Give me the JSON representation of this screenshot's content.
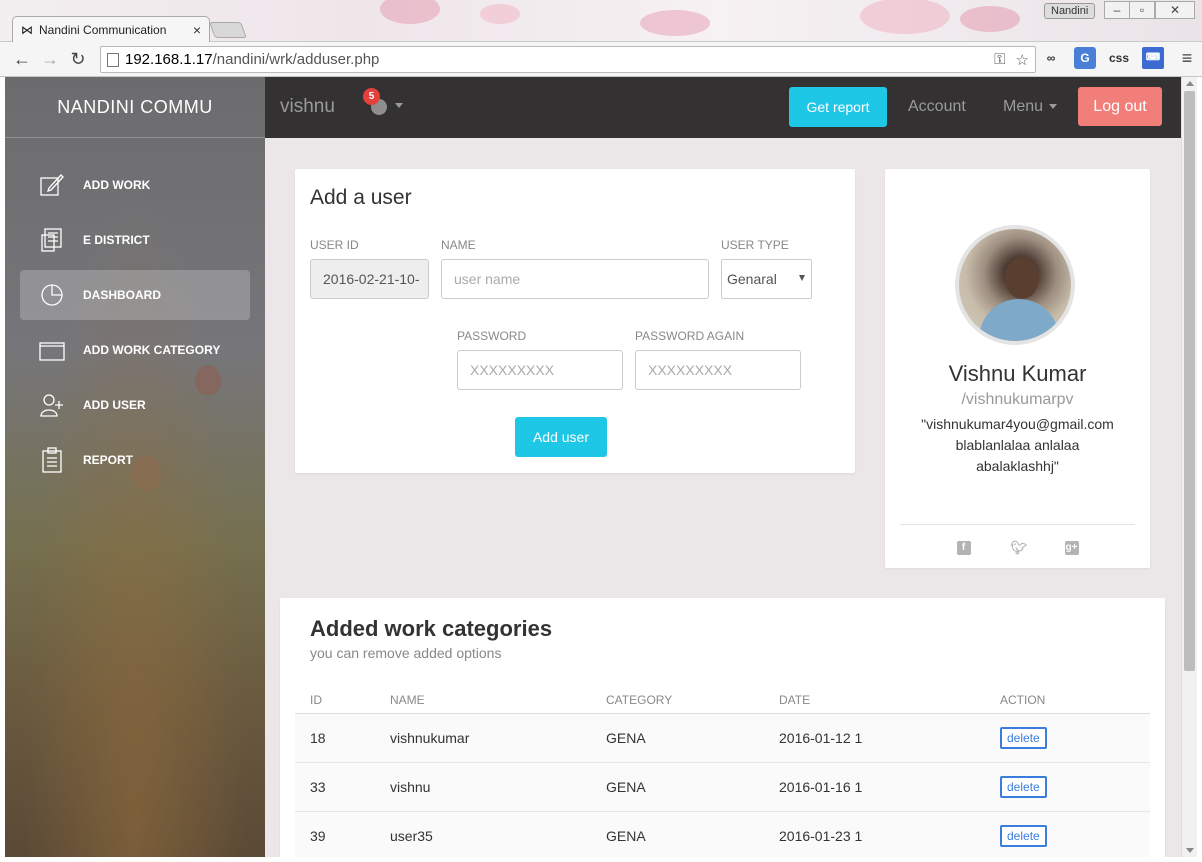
{
  "browser": {
    "tab_title": "Nandini Communication",
    "window_user": "Nandini",
    "url_host": "192.168.1.17",
    "url_path": "/nandini/wrk/adduser.php",
    "ext_css": "css"
  },
  "sidebar": {
    "brand": "NANDINI COMMU",
    "items": [
      {
        "label": "ADD WORK",
        "icon": "edit-icon"
      },
      {
        "label": "E DISTRICT",
        "icon": "document-stack-icon"
      },
      {
        "label": "DASHBOARD",
        "icon": "pie-chart-icon",
        "active": true
      },
      {
        "label": "ADD WORK CATEGORY",
        "icon": "folder-icon"
      },
      {
        "label": "ADD USER",
        "icon": "add-user-icon"
      },
      {
        "label": "REPORT",
        "icon": "clipboard-icon"
      }
    ]
  },
  "topnav": {
    "username": "vishnu",
    "notification_count": "5",
    "get_report": "Get report",
    "account": "Account",
    "menu": "Menu",
    "logout": "Log out"
  },
  "form": {
    "title": "Add a user",
    "user_id_label": "USER ID",
    "user_id_value": "2016-02-21-10-",
    "name_label": "NAME",
    "name_placeholder": "user name",
    "user_type_label": "USER TYPE",
    "user_type_value": "Genaral",
    "password_label": "PASSWORD",
    "password_placeholder": "XXXXXXXXX",
    "password_again_label": "PASSWORD AGAIN",
    "password_again_placeholder": "XXXXXXXXX",
    "submit": "Add user"
  },
  "profile": {
    "name": "Vishnu Kumar",
    "handle": "/vishnukumarpv",
    "bio": "\"vishnukumar4you@gmail.com blablanlalaa anlalaa abalaklashhj\""
  },
  "categories": {
    "title": "Added work categories",
    "subtitle": "you can remove added options",
    "columns": [
      "ID",
      "NAME",
      "CATEGORY",
      "DATE",
      "ACTION"
    ],
    "rows": [
      {
        "id": "18",
        "name": "vishnukumar",
        "category": "GENA",
        "date": "2016-01-12 1",
        "action": "delete"
      },
      {
        "id": "33",
        "name": "vishnu",
        "category": "GENA",
        "date": "2016-01-16 1",
        "action": "delete"
      },
      {
        "id": "39",
        "name": "user35",
        "category": "GENA",
        "date": "2016-01-23 1",
        "action": "delete"
      }
    ]
  },
  "colors": {
    "accent": "#1fc7e6",
    "danger": "#f27e7a",
    "topbar": "#333132",
    "badge": "#e4413b",
    "delete_link": "#3b7ddd"
  }
}
